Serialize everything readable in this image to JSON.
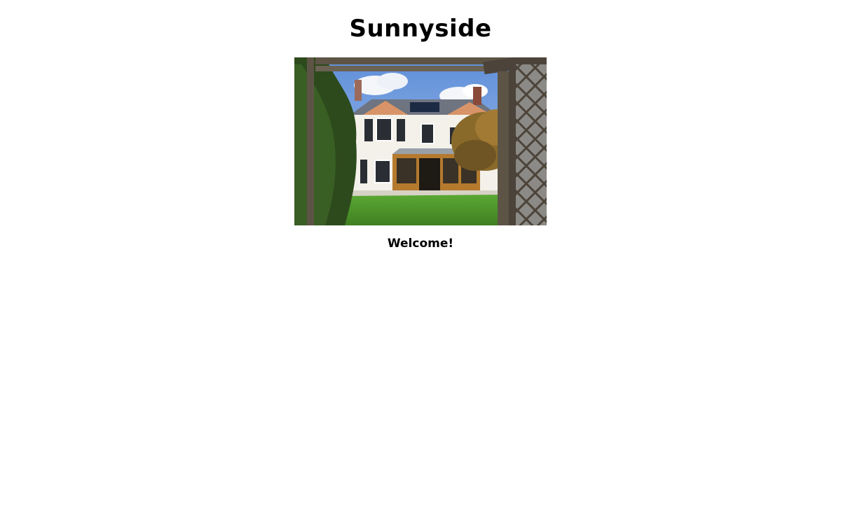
{
  "page": {
    "title": "Sunnyside",
    "welcome_text": "Welcome!"
  },
  "hero_photo": {
    "subject": "house-garden-photo",
    "colors": {
      "sky": "#7fa6e0",
      "cloud": "#f4f6fa",
      "roof": "#6e7480",
      "wall": "#f3f1ea",
      "lawn": "#4f9a2c",
      "hedge": "#2d4a1c",
      "timber": "#5d5446",
      "conservatory": "#b57a2e",
      "foliage": "#8a6a2a"
    }
  }
}
